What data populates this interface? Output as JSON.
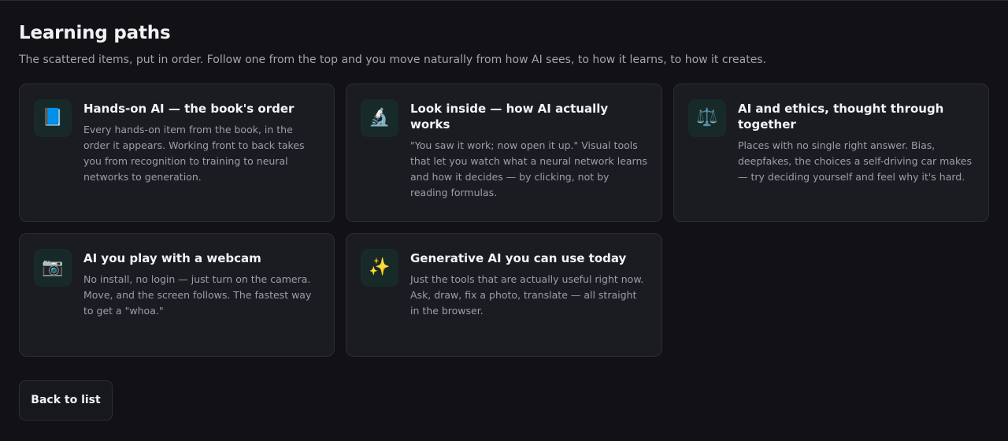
{
  "header": {
    "title": "Learning paths",
    "subtitle": "The scattered items, put in order. Follow one from the top and you move naturally from how AI sees, to how it learns, to how it creates."
  },
  "paths": [
    {
      "icon": "📘",
      "icon_name": "book-icon",
      "title": "Hands-on AI — the book's order",
      "description": "Every hands-on item from the book, in the order it appears. Working front to back takes you from recognition to training to neural networks to generation."
    },
    {
      "icon": "🔬",
      "icon_name": "microscope-icon",
      "title": "Look inside — how AI actually works",
      "description": "\"You saw it work; now open it up.\" Visual tools that let you watch what a neural network learns and how it decides — by clicking, not by reading formulas."
    },
    {
      "icon": "⚖️",
      "icon_name": "scales-icon",
      "title": "AI and ethics, thought through together",
      "description": "Places with no single right answer. Bias, deepfakes, the choices a self-driving car makes — try deciding yourself and feel why it's hard."
    },
    {
      "icon": "📷",
      "icon_name": "camera-icon",
      "title": "AI you play with a webcam",
      "description": "No install, no login — just turn on the camera. Move, and the screen follows. The fastest way to get a \"whoa.\""
    },
    {
      "icon": "✨",
      "icon_name": "sparkles-icon",
      "title": "Generative AI you can use today",
      "description": "Just the tools that are actually useful right now. Ask, draw, fix a photo, translate — all straight in the browser."
    }
  ],
  "back_button": {
    "label": "Back to list"
  },
  "colors": {
    "background": "#111116",
    "card": "#1b1c22",
    "icon_tile": "#172a28"
  }
}
